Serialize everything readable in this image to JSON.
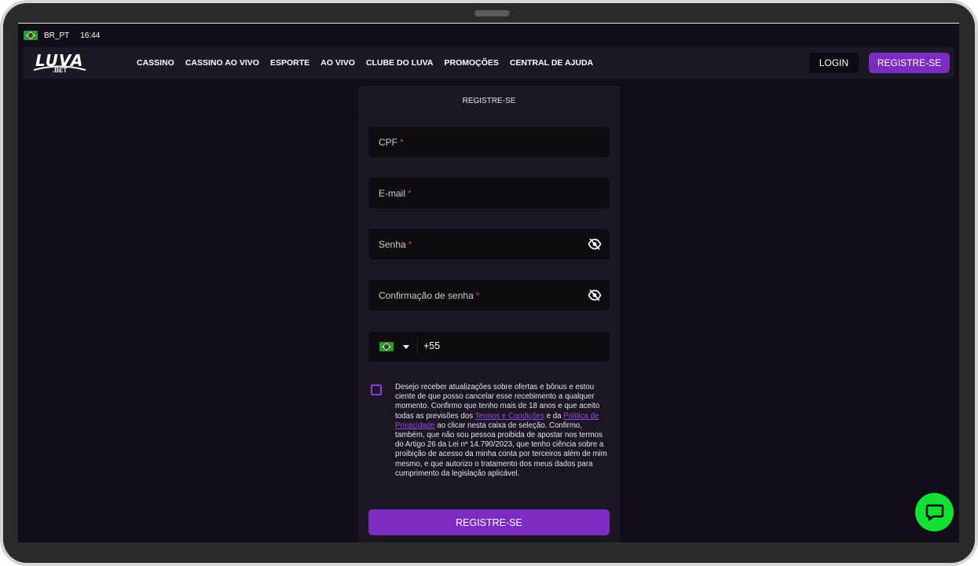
{
  "statusbar": {
    "flag_icon": "brazil-flag-icon",
    "locale": "BR_PT",
    "time": "16:44"
  },
  "nav": {
    "logo_main": "LUVA",
    "logo_sub": ".BET",
    "links": [
      "CASSINO",
      "CASSINO AO VIVO",
      "ESPORTE",
      "AO VIVO",
      "CLUBE DO LUVA",
      "PROMOÇÕES",
      "CENTRAL DE AJUDA"
    ],
    "login_label": "LOGIN",
    "register_label": "REGISTRE-SE"
  },
  "form": {
    "title": "REGISTRE-SE",
    "cpf_label": "CPF",
    "email_label": "E-mail",
    "password_label": "Senha",
    "confirm_password_label": "Confirmação de senha",
    "required_mark": "*",
    "phone_country_icon": "brazil-flag-icon",
    "phone_code": "+55",
    "consent": {
      "text_1": "Desejo receber atualizações sobre ofertas e bônus e estou ciente de que posso cancelar esse recebimento a qualquer momento. Confirmo que tenho mais de 18 anos e que aceito todas as previsões dos ",
      "terms_link": "Termos e Condições",
      "text_2": " e da ",
      "privacy_link": "Política de Privacidade",
      "text_3": " ao clicar nesta caixa de seleção. Confirmo, também, que não sou pessoa proibida de apostar nos termos do Artigo 26 da Lei nº 14.790/2023, que tenho ciência sobre a proibição de acesso da minha conta por terceiros além de mim mesmo, e que autorizo o tratamento dos meus dados para cumprimento da legislação aplicável."
    },
    "submit_label": "REGISTRE-SE"
  },
  "colors": {
    "accent": "#7e2bc2",
    "background": "#120d17",
    "chat": "#12e032",
    "required": "#e0384a"
  },
  "chat": {
    "icon": "chat-bubble-icon"
  }
}
